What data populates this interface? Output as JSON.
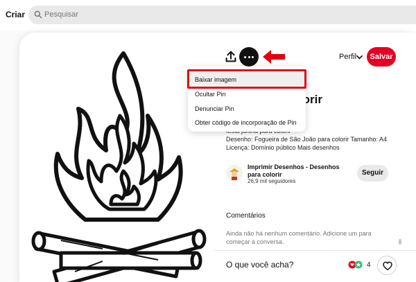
{
  "topbar": {
    "create_label": "Criar",
    "search_placeholder": "Pesquisar"
  },
  "pin": {
    "title": "João para colorir\nhos",
    "description": "festa junina para colorir\nDesenho: Fogueira de São João para colorir Tamanho: A4\nLicença: Domínio público Mais desenhos",
    "profile_label": "Perfil",
    "save_label": "Salvar"
  },
  "menu": {
    "items": [
      "Baixar imagem",
      "Ocultar Pin",
      "Denunciar Pin",
      "Obter código de incorporação de Pin"
    ]
  },
  "creator": {
    "name": "Imprimir Desenhos - Desenhos para colorir",
    "followers": "26,9 mil seguidores",
    "follow_label": "Seguir"
  },
  "comments": {
    "heading": "Comentários",
    "empty_text": "Ainda não há nenhum comentário. Adicione um para começar a conversa."
  },
  "footer": {
    "prompt": "O que você acha?",
    "reaction_count": "4"
  },
  "colors": {
    "accent_red": "#e60023",
    "annotation_red": "#e3000f"
  }
}
